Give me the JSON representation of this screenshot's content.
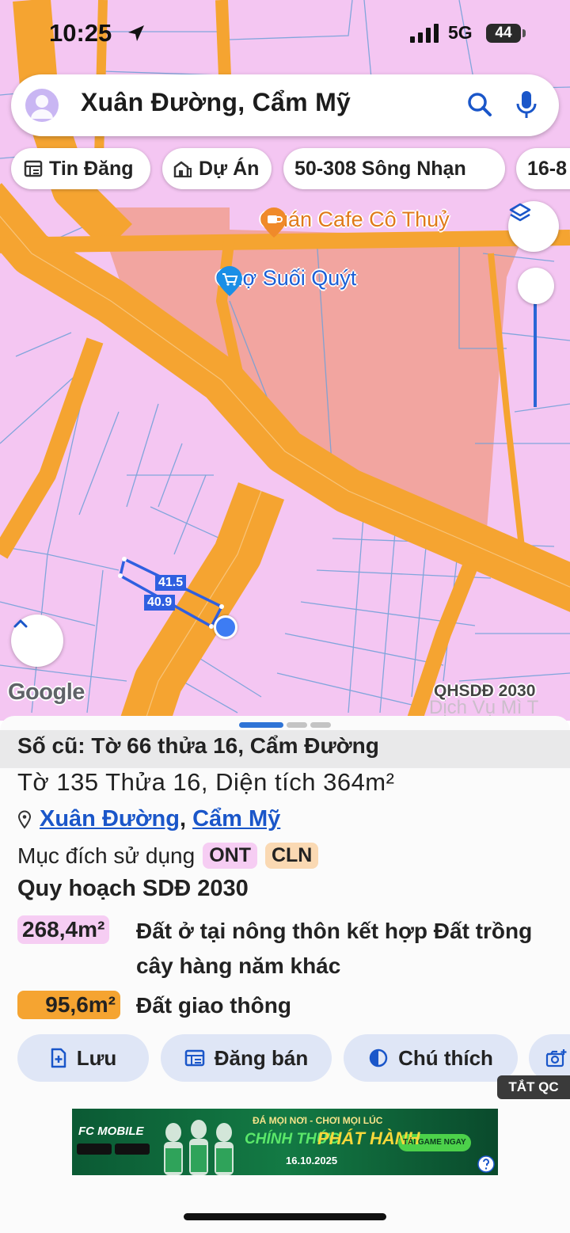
{
  "status": {
    "time": "10:25",
    "network": "5G",
    "battery": "44"
  },
  "search": {
    "query": "Xuân Đường, Cẩm Mỹ"
  },
  "chips": [
    {
      "label": "Tin Đăng",
      "icon": "listing-icon"
    },
    {
      "label": "Dự Án",
      "icon": "building-icon"
    },
    {
      "label": "50-308 Sông Nhạn",
      "icon": ""
    },
    {
      "label": "16-8",
      "icon": ""
    }
  ],
  "map": {
    "poi_cafe": "Quán Cafe Cô Thuỷ",
    "poi_market": "Chợ Suối Quýt",
    "dim_top": "41.5",
    "dim_bottom": "40.9",
    "google": "Google",
    "layer_label": "QHSDĐ 2030",
    "faded_text": "Dịch Vụ Mì T"
  },
  "sheet": {
    "old_number": "Số cũ: Tờ 66 thửa 16, Cẩm Đường",
    "info": "Tờ 135 Thửa 16, Diện tích 364m²",
    "addr_1": "Xuân Đường",
    "addr_sep": ",",
    "addr_2": "Cẩm Mỹ",
    "purpose_label": "Mục đích sử dụng",
    "tag_1": "ONT",
    "tag_2": "CLN",
    "plan_title": "Quy hoạch SDĐ 2030",
    "area_1": "268,4m²",
    "desc_1": "Đất ở tại nông thôn kết hợp Đất trồng cây hàng năm khác",
    "area_2": "95,6m²",
    "desc_2": "Đất giao thông"
  },
  "actions": {
    "save": "Lưu",
    "post": "Đăng bán",
    "legend": "Chú thích"
  },
  "ad": {
    "hide_label": "TẮT QC",
    "brand": "FC MOBILE",
    "tagline": "ĐÁ MỌI NƠI - CHƠI MỌI LÚC",
    "headline_1": "CHÍNH THỨC",
    "headline_2": "PHÁT HÀNH",
    "date": "16.10.2025",
    "cta": "TẢI GAME NGAY"
  },
  "colors": {
    "road": "#f5a431",
    "residential": "#f4c6f2",
    "market": "#f2a5a0",
    "accent": "#2f5fe0"
  }
}
